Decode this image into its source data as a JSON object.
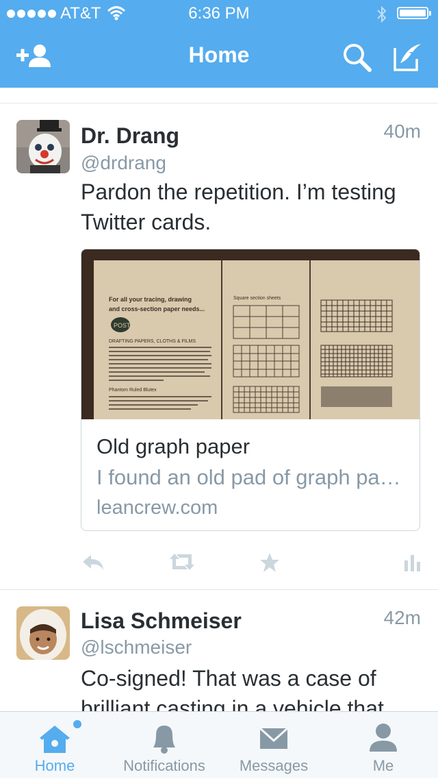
{
  "status_bar": {
    "carrier": "AT&T",
    "time": "6:36 PM",
    "signal_dots": 5,
    "battery_level": 1.0
  },
  "nav": {
    "title": "Home",
    "left_icon": "add-user-icon",
    "right_icons": [
      "search-icon",
      "compose-icon"
    ]
  },
  "tweets": [
    {
      "name": "Dr. Drang",
      "handle": "@drdrang",
      "time": "40m",
      "text": "Pardon the repetition. I’m testing Twitter cards.",
      "card": {
        "title": "Old graph paper",
        "description": "I found an old pad of graph paper in my office.",
        "domain": "leancrew.com",
        "image": {
          "heading": "For all your tracing, drawing and cross-section paper needs...",
          "logo": "POST",
          "col2_heading": "Square section sheets",
          "subheading": "DRAFTING PAPERS, CLOTHS & FILMS",
          "subheading2": "Phantom Ruled Blutex"
        }
      },
      "actions": [
        "reply-icon",
        "retweet-icon",
        "favorite-icon",
        "stats-icon"
      ]
    },
    {
      "name": "Lisa Schmeiser",
      "handle": "@lschmeiser",
      "time": "42m",
      "text": "Co-signed! That was a case of brilliant casting in a vehicle that"
    }
  ],
  "tabbar": {
    "items": [
      {
        "label": "Home",
        "icon": "home-icon",
        "active": true
      },
      {
        "label": "Notifications",
        "icon": "bell-icon",
        "active": false
      },
      {
        "label": "Messages",
        "icon": "envelope-icon",
        "active": false
      },
      {
        "label": "Me",
        "icon": "person-icon",
        "active": false
      }
    ]
  },
  "colors": {
    "brand": "#55acee",
    "text": "#292f33",
    "muted": "#8899a6",
    "divider": "#e1e8ed"
  }
}
